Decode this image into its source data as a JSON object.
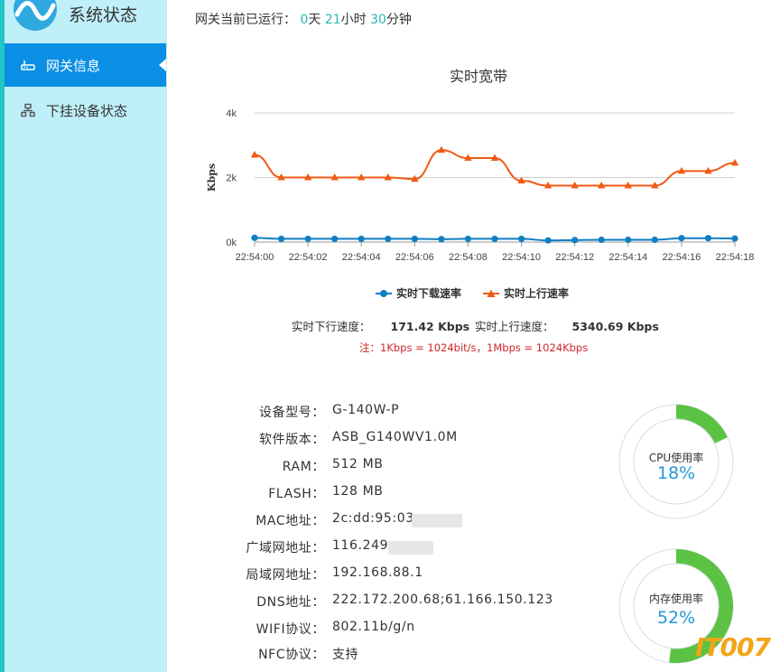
{
  "brand": {
    "title": "系统状态"
  },
  "nav": [
    {
      "label": "网关信息",
      "active": true,
      "icon": "router-icon"
    },
    {
      "label": "下挂设备状态",
      "active": false,
      "icon": "network-devices-icon"
    }
  ],
  "uptime": {
    "prefix": "网关当前已运行：",
    "days": "0",
    "days_unit": "天",
    "hours": "21",
    "hours_unit": "小时",
    "minutes": "30",
    "minutes_unit": "分钟"
  },
  "chart_data": {
    "type": "line",
    "title": "实时宽带",
    "ylabel": "Kbps",
    "xlabel": "",
    "ylim": [
      0,
      4000
    ],
    "yticks": [
      "0k",
      "2k",
      "4k"
    ],
    "x": [
      "22:54:00",
      "22:54:01",
      "22:54:02",
      "22:54:03",
      "22:54:04",
      "22:54:05",
      "22:54:06",
      "22:54:07",
      "22:54:08",
      "22:54:09",
      "22:54:10",
      "22:54:11",
      "22:54:12",
      "22:54:13",
      "22:54:14",
      "22:54:15",
      "22:54:16",
      "22:54:17",
      "22:54:18"
    ],
    "xtick_labels": [
      "22:54:00",
      "22:54:02",
      "22:54:04",
      "22:54:06",
      "22:54:08",
      "22:54:10",
      "22:54:12",
      "22:54:14",
      "22:54:16",
      "22:54:18"
    ],
    "grid": true,
    "legend_position": "bottom",
    "series": [
      {
        "name": "实时下载速率",
        "color": "#0f7fc4",
        "marker": "circle",
        "values": [
          130,
          100,
          100,
          100,
          100,
          100,
          100,
          90,
          100,
          100,
          100,
          50,
          60,
          70,
          70,
          70,
          120,
          120,
          110
        ]
      },
      {
        "name": "实时上行速率",
        "color": "#f05a14",
        "marker": "triangle",
        "values": [
          2700,
          2000,
          2000,
          2000,
          2000,
          2000,
          1950,
          2850,
          2600,
          2600,
          1900,
          1750,
          1750,
          1750,
          1750,
          1750,
          2200,
          2200,
          2450
        ]
      }
    ]
  },
  "speeds": {
    "down_label": "实时下行速度：",
    "down_value": "171.42 Kbps",
    "up_label": "实时上行速度：",
    "up_value": "5340.69 Kbps"
  },
  "note": "注：1Kbps = 1024bit/s，1Mbps = 1024Kbps",
  "info": [
    {
      "key": "设备型号：",
      "value": "G-140W-P"
    },
    {
      "key": "软件版本：",
      "value": "ASB_G140WV1.0M"
    },
    {
      "key": "RAM：",
      "value": "512 MB"
    },
    {
      "key": "FLASH：",
      "value": "128 MB"
    },
    {
      "key": "MAC地址：",
      "value": "2c:dd:95:03"
    },
    {
      "key": "广域网地址：",
      "value": "116.249"
    },
    {
      "key": "局域网地址：",
      "value": "192.168.88.1"
    },
    {
      "key": "DNS地址：",
      "value": "222.172.200.68;61.166.150.123"
    },
    {
      "key": "WIFI协议：",
      "value": "802.11b/g/n"
    },
    {
      "key": "NFC协议：",
      "value": "支持"
    }
  ],
  "gauges": [
    {
      "label": "CPU使用率",
      "value": "18%",
      "percent": 18,
      "color": "#5cc244"
    },
    {
      "label": "内存使用率",
      "value": "52%",
      "percent": 52,
      "color": "#5cc244"
    }
  ],
  "watermark": "IT007"
}
